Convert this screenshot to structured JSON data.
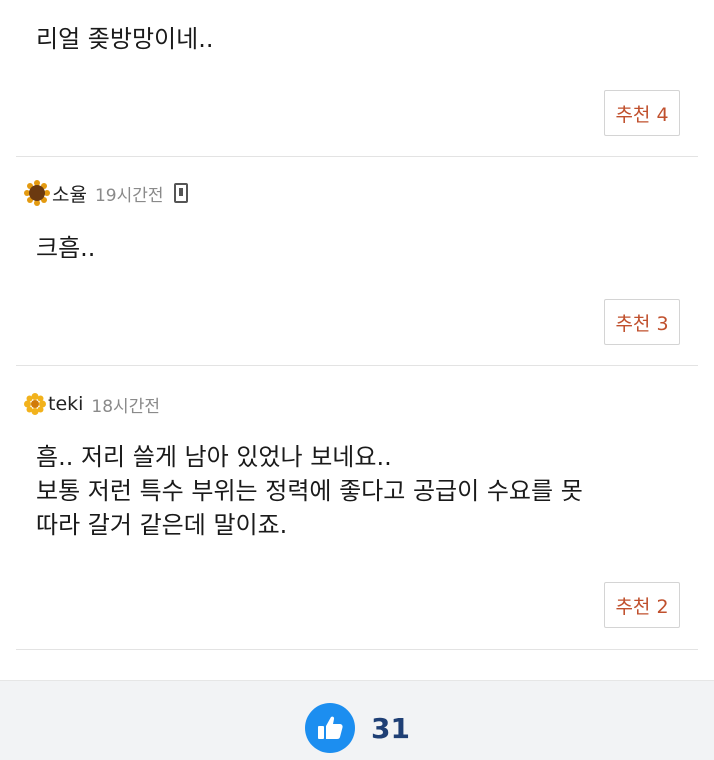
{
  "comments": [
    {
      "text": "리얼 좆방망이네..",
      "recommend_label": "추천 4"
    },
    {
      "nickname": "소율",
      "time": "19시간전",
      "mobile": true,
      "avatar_icon": "sunflower-icon",
      "text": "크흠..",
      "recommend_label": "추천 3"
    },
    {
      "nickname": "teki",
      "time": "18시간전",
      "avatar_icon": "flower-icon",
      "text": "흠.. 저리 쓸게 남아 있었나 보네요..\n보통 저런 특수 부위는 정력에 좋다고 공급이 수요를 못\n따라 갈거 같은데 말이죠.",
      "recommend_label": "추천 2"
    }
  ],
  "footer": {
    "like_icon": "thumbs-up-icon",
    "like_count": "31"
  },
  "colors": {
    "recommend": "#c0502d",
    "like_blue": "#1c8ef0",
    "count_navy": "#1f3f75"
  }
}
